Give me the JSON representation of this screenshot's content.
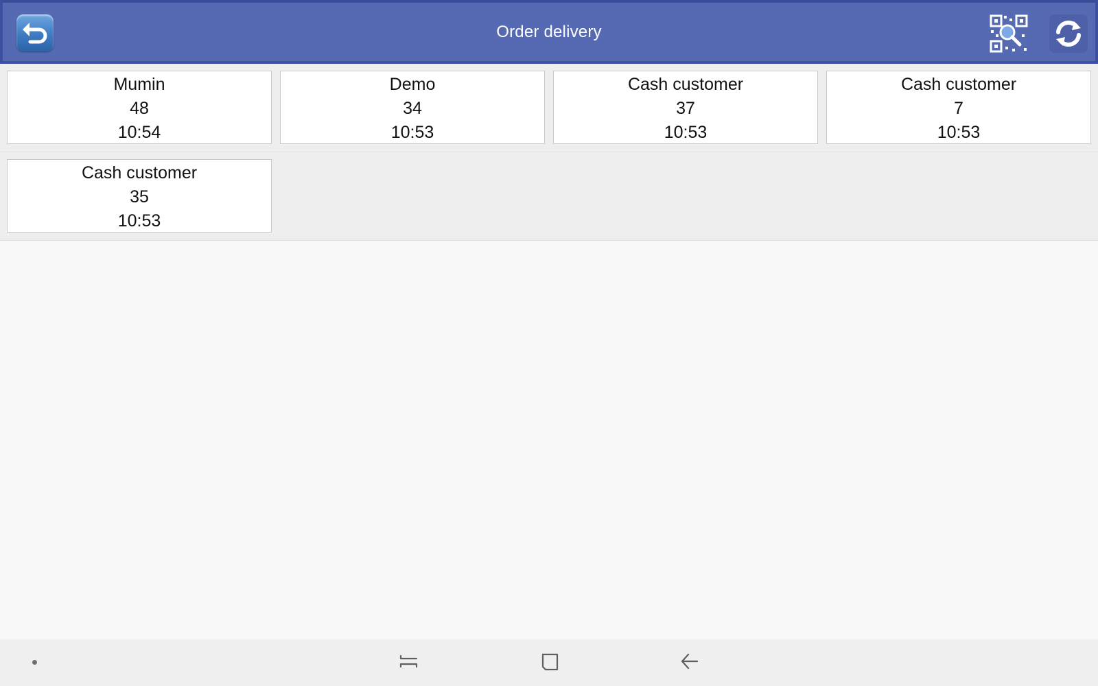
{
  "header": {
    "title": "Order delivery",
    "back_icon": "back-arrow-icon",
    "qr_icon": "qr-search-icon",
    "refresh_icon": "refresh-icon",
    "background_color": "#5669b3"
  },
  "orders": [
    {
      "customer": "Mumin",
      "number": "48",
      "time": "10:54"
    },
    {
      "customer": "Demo",
      "number": "34",
      "time": "10:53"
    },
    {
      "customer": "Cash customer",
      "number": "37",
      "time": "10:53"
    },
    {
      "customer": "Cash customer",
      "number": "7",
      "time": "10:53"
    },
    {
      "customer": "Cash customer",
      "number": "35",
      "time": "10:53"
    }
  ],
  "navbar": {
    "items": [
      "dot-indicator",
      "recent-apps-icon",
      "home-icon",
      "back-nav-icon"
    ]
  }
}
